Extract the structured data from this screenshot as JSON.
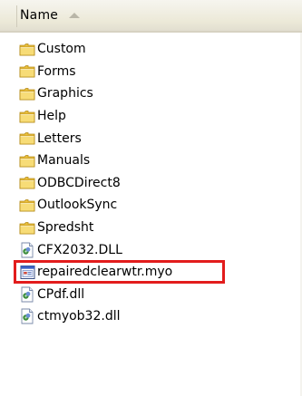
{
  "header": {
    "name_label": "Name"
  },
  "colors": {
    "highlight_border": "#e21c1c",
    "folder_fill": "#f5d96b",
    "folder_tab": "#e9bf3c"
  },
  "files": [
    {
      "label": "Custom",
      "icon": "folder-icon"
    },
    {
      "label": "Forms",
      "icon": "folder-icon"
    },
    {
      "label": "Graphics",
      "icon": "folder-icon"
    },
    {
      "label": "Help",
      "icon": "folder-icon"
    },
    {
      "label": "Letters",
      "icon": "folder-icon"
    },
    {
      "label": "Manuals",
      "icon": "folder-icon"
    },
    {
      "label": "ODBCDirect8",
      "icon": "folder-icon"
    },
    {
      "label": "OutlookSync",
      "icon": "folder-icon"
    },
    {
      "label": "Spredsht",
      "icon": "folder-icon"
    },
    {
      "label": "CFX2032.DLL",
      "icon": "dll-file-icon"
    },
    {
      "label": "repairedclearwtr.myo",
      "icon": "myob-file-icon",
      "highlighted": true
    },
    {
      "label": "CPdf.dll",
      "icon": "dll-file-icon"
    },
    {
      "label": "ctmyob32.dll",
      "icon": "dll-file-icon"
    }
  ]
}
